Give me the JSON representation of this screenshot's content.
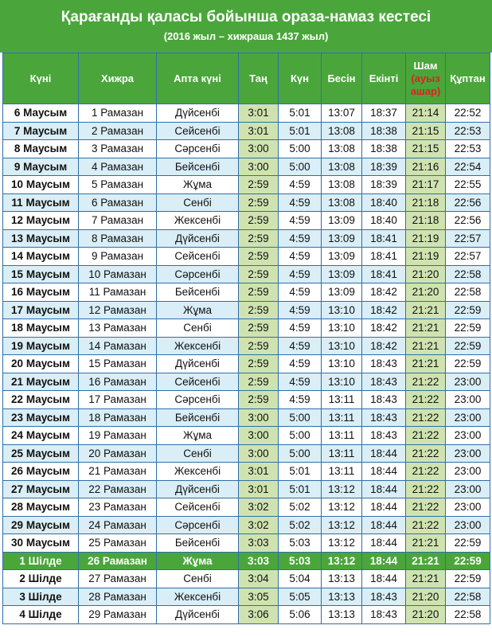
{
  "title": "Қарағанды қаласы бойынша ораза-намаз кестесі",
  "subtitle": "(2016 жыл – хижраша 1437 жыл)",
  "headers": {
    "day": "Күні",
    "hijri": "Хижра",
    "weekday": "Апта күні",
    "fajr": "Таң",
    "sunrise": "Күн",
    "dhuhr": "Бесін",
    "asr": "Екінті",
    "maghrib": "Шам",
    "maghrib_note_line1": "(ауыз",
    "maghrib_note_line2": "ашар)",
    "isha": "Құптан"
  },
  "highlight_color": "#cfe3b0",
  "header_color": "#4aa63a",
  "stripe_color": "#d9eef6",
  "current_row_index": 25,
  "rows": [
    [
      "6 Маусым",
      "1 Рамазан",
      "Дүйсенбі",
      "3:01",
      "5:01",
      "13:07",
      "18:37",
      "21:14",
      "22:52"
    ],
    [
      "7 Маусым",
      "2 Рамазан",
      "Сейсенбі",
      "3:01",
      "5:01",
      "13:08",
      "18:38",
      "21:15",
      "22:53"
    ],
    [
      "8 Маусым",
      "3 Рамазан",
      "Сәрсенбі",
      "3:00",
      "5:00",
      "13:08",
      "18:38",
      "21:15",
      "22:53"
    ],
    [
      "9 Маусым",
      "4 Рамазан",
      "Бейсенбі",
      "3:00",
      "5:00",
      "13:08",
      "18:39",
      "21:16",
      "22:54"
    ],
    [
      "10 Маусым",
      "5 Рамазан",
      "Жұма",
      "2:59",
      "4:59",
      "13:08",
      "18:39",
      "21:17",
      "22:55"
    ],
    [
      "11 Маусым",
      "6 Рамазан",
      "Сенбі",
      "2:59",
      "4:59",
      "13:08",
      "18:40",
      "21:18",
      "22:56"
    ],
    [
      "12 Маусым",
      "7 Рамазан",
      "Жексенбі",
      "2:59",
      "4:59",
      "13:09",
      "18:40",
      "21:18",
      "22:56"
    ],
    [
      "13 Маусым",
      "8 Рамазан",
      "Дүйсенбі",
      "2:59",
      "4:59",
      "13:09",
      "18:41",
      "21:19",
      "22:57"
    ],
    [
      "14 Маусым",
      "9 Рамазан",
      "Сейсенбі",
      "2:59",
      "4:59",
      "13:09",
      "18:41",
      "21:19",
      "22:57"
    ],
    [
      "15 Маусым",
      "10 Рамазан",
      "Сәрсенбі",
      "2:59",
      "4:59",
      "13:09",
      "18:41",
      "21:20",
      "22:58"
    ],
    [
      "16 Маусым",
      "11 Рамазан",
      "Бейсенбі",
      "2:59",
      "4:59",
      "13:09",
      "18:42",
      "21:20",
      "22:58"
    ],
    [
      "17 Маусым",
      "12 Рамазан",
      "Жұма",
      "2:59",
      "4:59",
      "13:10",
      "18:42",
      "21:21",
      "22:59"
    ],
    [
      "18 Маусым",
      "13 Рамазан",
      "Сенбі",
      "2:59",
      "4:59",
      "13:10",
      "18:42",
      "21:21",
      "22:59"
    ],
    [
      "19 Маусым",
      "14 Рамазан",
      "Жексенбі",
      "2:59",
      "4:59",
      "13:10",
      "18:42",
      "21:21",
      "22:59"
    ],
    [
      "20 Маусым",
      "15 Рамазан",
      "Дүйсенбі",
      "2:59",
      "4:59",
      "13:10",
      "18:43",
      "21:21",
      "22:59"
    ],
    [
      "21 Маусым",
      "16 Рамазан",
      "Сейсенбі",
      "2:59",
      "4:59",
      "13:10",
      "18:43",
      "21:22",
      "23:00"
    ],
    [
      "22 Маусым",
      "17 Рамазан",
      "Сәрсенбі",
      "2:59",
      "4:59",
      "13:11",
      "18:43",
      "21:22",
      "23:00"
    ],
    [
      "23 Маусым",
      "18 Рамазан",
      "Бейсенбі",
      "3:00",
      "5:00",
      "13:11",
      "18:43",
      "21:22",
      "23:00"
    ],
    [
      "24 Маусым",
      "19 Рамазан",
      "Жұма",
      "3:00",
      "5:00",
      "13:11",
      "18:43",
      "21:22",
      "23:00"
    ],
    [
      "25 Маусым",
      "20 Рамазан",
      "Сенбі",
      "3:00",
      "5:00",
      "13:11",
      "18:44",
      "21:22",
      "23:00"
    ],
    [
      "26 Маусым",
      "21 Рамазан",
      "Жексенбі",
      "3:01",
      "5:01",
      "13:11",
      "18:44",
      "21:22",
      "23:00"
    ],
    [
      "27 Маусым",
      "22 Рамазан",
      "Дүйсенбі",
      "3:01",
      "5:01",
      "13:12",
      "18:44",
      "21:22",
      "23:00"
    ],
    [
      "28 Маусым",
      "23 Рамазан",
      "Сейсенбі",
      "3:02",
      "5:02",
      "13:12",
      "18:44",
      "21:22",
      "23:00"
    ],
    [
      "29 Маусым",
      "24 Рамазан",
      "Сәрсенбі",
      "3:02",
      "5:02",
      "13:12",
      "18:44",
      "21:22",
      "23:00"
    ],
    [
      "30 Маусым",
      "25 Рамазан",
      "Бейсенбі",
      "3:03",
      "5:03",
      "13:12",
      "18:44",
      "21:21",
      "22:59"
    ],
    [
      "1 Шілде",
      "26 Рамазан",
      "Жұма",
      "3:03",
      "5:03",
      "13:12",
      "18:44",
      "21:21",
      "22:59"
    ],
    [
      "2 Шілде",
      "27 Рамазан",
      "Сенбі",
      "3:04",
      "5:04",
      "13:13",
      "18:44",
      "21:21",
      "22:59"
    ],
    [
      "3 Шілде",
      "28 Рамазан",
      "Жексенбі",
      "3:05",
      "5:05",
      "13:13",
      "18:43",
      "21:20",
      "22:58"
    ],
    [
      "4 Шілде",
      "29 Рамазан",
      "Дүйсенбі",
      "3:06",
      "5:06",
      "13:13",
      "18:43",
      "21:20",
      "22:58"
    ]
  ]
}
